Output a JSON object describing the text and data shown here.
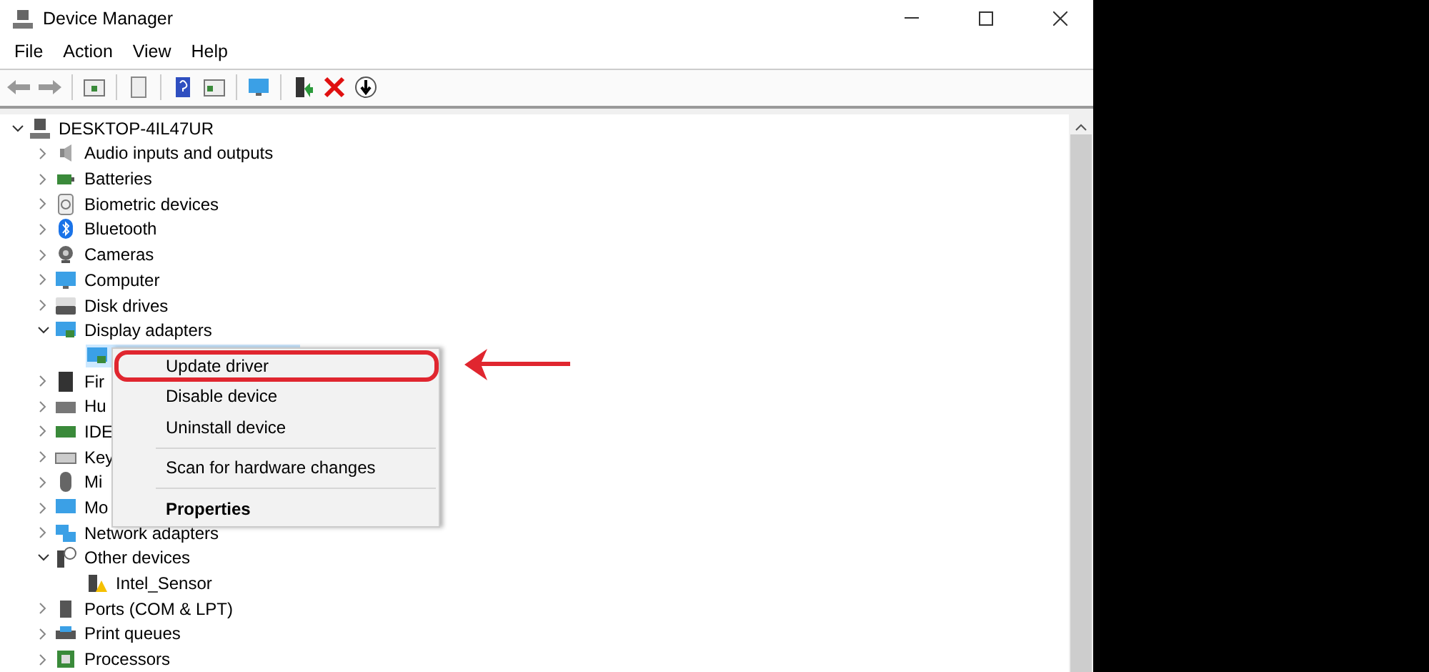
{
  "window": {
    "title": "Device Manager"
  },
  "menu_bar": [
    "File",
    "Action",
    "View",
    "Help"
  ],
  "tree": {
    "label": "DESKTOP-4IL47UR",
    "expanded": true,
    "children": [
      {
        "label": "Audio inputs and outputs",
        "expanded": false
      },
      {
        "label": "Batteries",
        "expanded": false
      },
      {
        "label": "Biometric devices",
        "expanded": false
      },
      {
        "label": "Bluetooth",
        "expanded": false
      },
      {
        "label": "Cameras",
        "expanded": false
      },
      {
        "label": "Computer",
        "expanded": false
      },
      {
        "label": "Disk drives",
        "expanded": false
      },
      {
        "label": "Display adapters",
        "expanded": true,
        "children": [
          {
            "selected": true
          }
        ]
      },
      {
        "label": "Fir",
        "expanded": false
      },
      {
        "label": "Hu",
        "expanded": false
      },
      {
        "label": "IDE",
        "expanded": false
      },
      {
        "label": "Key",
        "expanded": false
      },
      {
        "label": "Mi",
        "expanded": false
      },
      {
        "label": "Mo",
        "expanded": false
      },
      {
        "label": "Network adapters",
        "expanded": false
      },
      {
        "label": "Other devices",
        "expanded": true,
        "children": [
          {
            "label": "Intel_Sensor",
            "selected": false,
            "warning": true
          }
        ]
      },
      {
        "label": "Ports (COM & LPT)",
        "expanded": false
      },
      {
        "label": "Print queues",
        "expanded": false
      },
      {
        "label": "Processors",
        "expanded": false
      }
    ]
  },
  "context_menu": [
    {
      "kind": "item",
      "label": "Update driver",
      "annotated": true
    },
    {
      "kind": "item",
      "label": "Disable device",
      "annotated": false
    },
    {
      "kind": "item",
      "label": "Uninstall device",
      "annotated": false
    },
    {
      "kind": "separator"
    },
    {
      "kind": "item",
      "label": "Scan for hardware changes",
      "annotated": false
    },
    {
      "kind": "separator"
    },
    {
      "kind": "default",
      "label": "Properties",
      "annotated": false
    }
  ]
}
